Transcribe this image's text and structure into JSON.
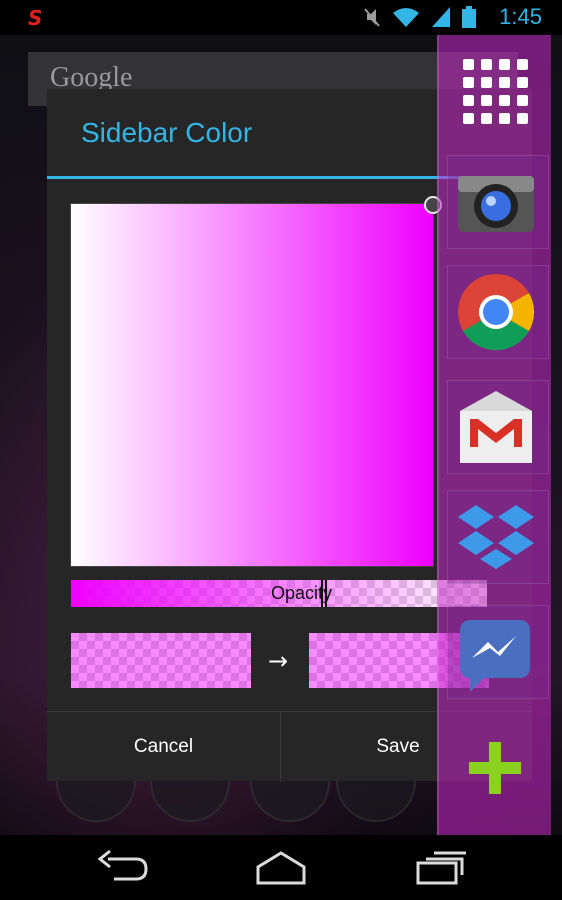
{
  "status_bar": {
    "time": "1:45",
    "icons": [
      "app-notification-icon",
      "mute-icon",
      "wifi-icon",
      "signal-icon",
      "battery-icon"
    ]
  },
  "background": {
    "search_bar_text": "Google"
  },
  "dialog": {
    "title": "Sidebar Color",
    "opacity_label": "Opacity",
    "opacity_value": 0.6,
    "selected_color": "#ee00ff",
    "arrow": "→",
    "buttons": {
      "cancel": "Cancel",
      "save": "Save"
    }
  },
  "sidebar": {
    "items": [
      {
        "icon": "app-drawer-grid-icon"
      },
      {
        "icon": "camera-icon"
      },
      {
        "icon": "chrome-icon"
      },
      {
        "icon": "gmail-icon"
      },
      {
        "icon": "dropbox-icon"
      },
      {
        "icon": "messenger-icon"
      },
      {
        "icon": "add-icon"
      }
    ]
  },
  "colors": {
    "accent": "#33b5e5",
    "sidebar_tint": "#c828c8",
    "dialog_bg": "#262626"
  },
  "nav_bar": {
    "buttons": [
      "back-icon",
      "home-icon",
      "recent-apps-icon"
    ]
  }
}
